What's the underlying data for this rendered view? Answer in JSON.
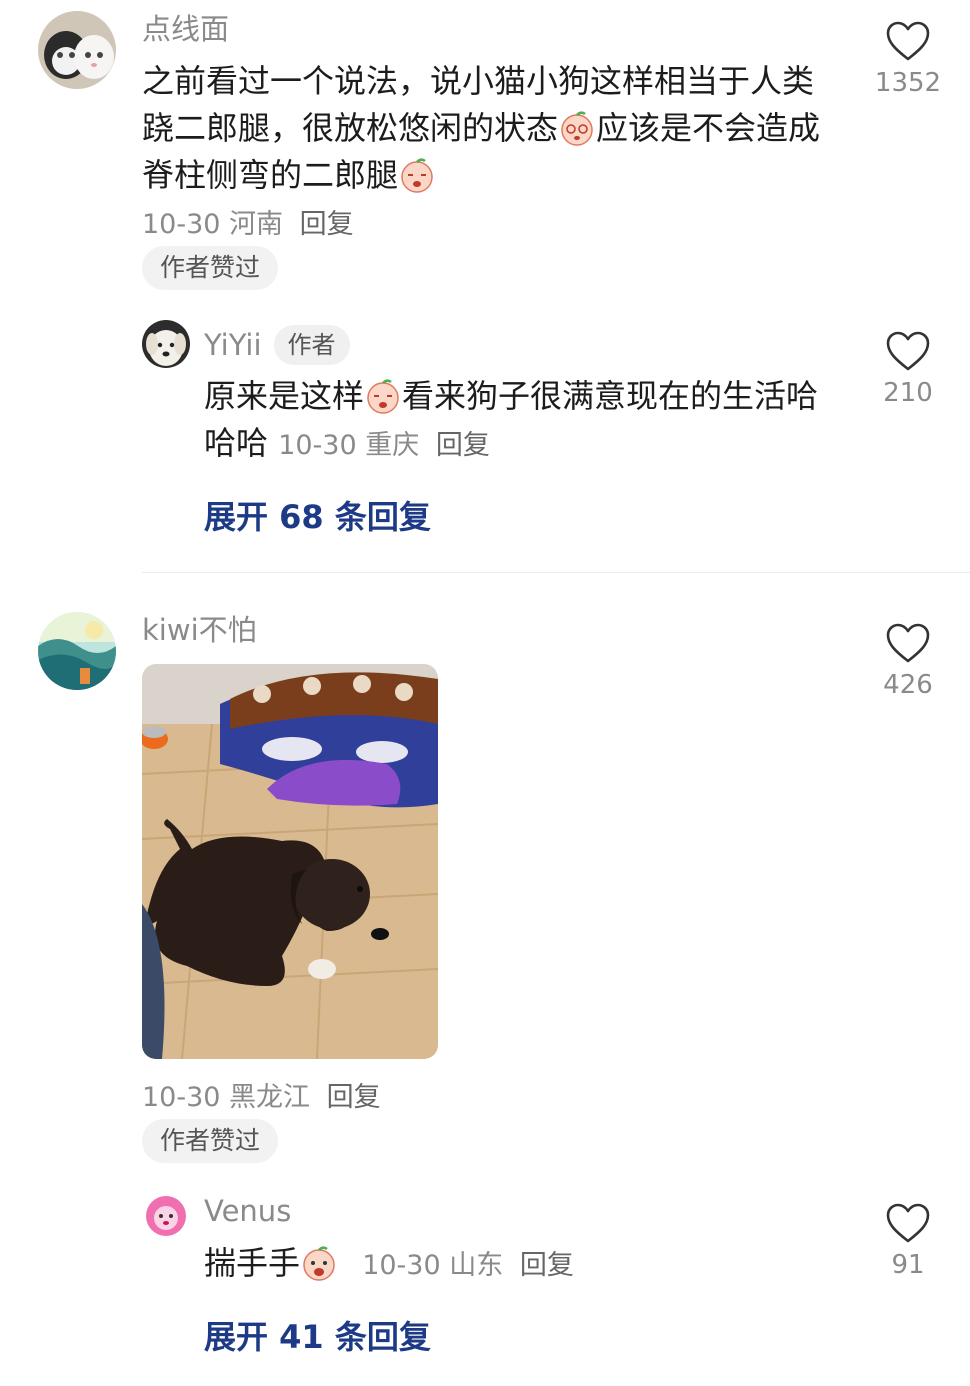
{
  "comments": [
    {
      "user": "点线面",
      "text_parts": [
        "之前看过一个说法，说小猫小狗这样相当于人类跷二郎腿，很放松悠闲的状态",
        "应该是不会造成脊柱侧弯的二郎腿"
      ],
      "date": "10-30",
      "location": "河南",
      "reply_label": "回复",
      "badge": "作者赞过",
      "likes": "1352",
      "reply": {
        "user": "YiYii",
        "author_tag": "作者",
        "text_parts": [
          "原来是这样",
          "看来狗子很满意现在的生活哈哈哈"
        ],
        "date": "10-30",
        "location": "重庆",
        "reply_label": "回复",
        "likes": "210"
      },
      "expand_label": "展开 68 条回复"
    },
    {
      "user": "kiwi不怕",
      "date": "10-30",
      "location": "黑龙江",
      "reply_label": "回复",
      "badge": "作者赞过",
      "likes": "426",
      "reply": {
        "user": "Venus",
        "text_parts": [
          "揣手手"
        ],
        "date": "10-30",
        "location": "山东",
        "reply_label": "回复",
        "likes": "91"
      },
      "expand_label": "展开 41 条回复"
    }
  ],
  "icons": {
    "like": "heart-outline-icon",
    "emoji": "peach-face-emoji-icon"
  },
  "colors": {
    "name_gray": "#8a8a8a",
    "expand_blue": "#1d3a86",
    "chip_bg": "#f2f2f2"
  }
}
